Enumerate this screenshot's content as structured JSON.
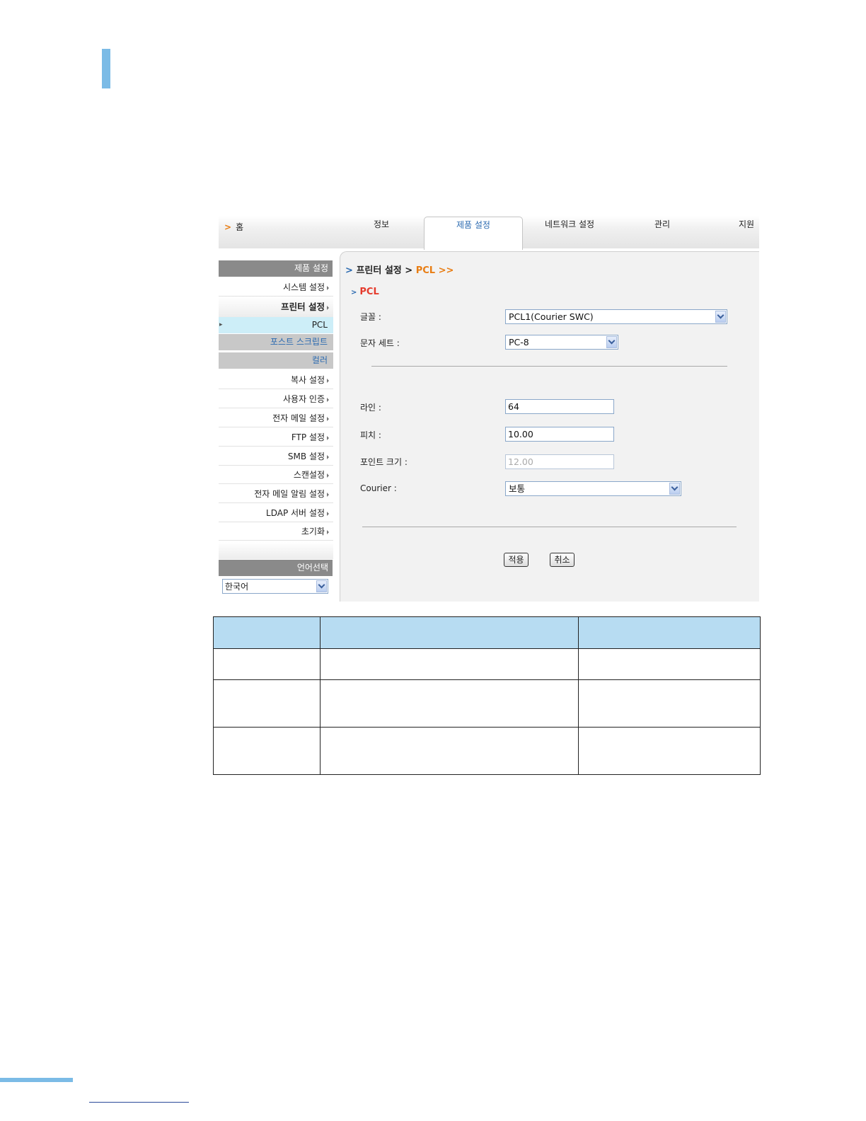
{
  "nav": {
    "home": "홈",
    "tabs": [
      "정보",
      "제품 설정",
      "네트워크 설정",
      "관리",
      "지원"
    ],
    "active_tab": "제품 설정"
  },
  "sidebar": {
    "header": "제품 설정",
    "items": [
      "시스템 설정",
      "프린터 설정"
    ],
    "subitems": [
      "PCL",
      "포스트 스크립트",
      "컬러"
    ],
    "items_after": [
      "복사 설정",
      "사용자 인증",
      "전자 메일 설정",
      "FTP 설정",
      "SMB 설정",
      "스캔설정",
      "전자 메일 알림 설정",
      "LDAP 서버 설정",
      "초기화"
    ],
    "language_header": "언어선택",
    "language_value": "한국어"
  },
  "main": {
    "breadcrumb_parent": "프린터 설정",
    "breadcrumb_current": "PCL >>",
    "section_title": "PCL",
    "fields": {
      "font_label": "글꼴 :",
      "font_value": "PCL1(Courier SWC)",
      "symbol_set_label": "문자 세트 :",
      "symbol_set_value": "PC-8",
      "lines_label": "라인 :",
      "lines_value": "64",
      "pitch_label": "피치 :",
      "pitch_value": "10.00",
      "point_size_label": "포인트 크기 :",
      "point_size_value": "12.00",
      "courier_label": "Courier :",
      "courier_value": "보통"
    },
    "apply_label": "적용",
    "cancel_label": "취소"
  },
  "colors": {
    "accent_blue": "#7bbbe6",
    "table_header": "#b7dcf2",
    "orange": "#e87d13",
    "red": "#e53a2c"
  }
}
